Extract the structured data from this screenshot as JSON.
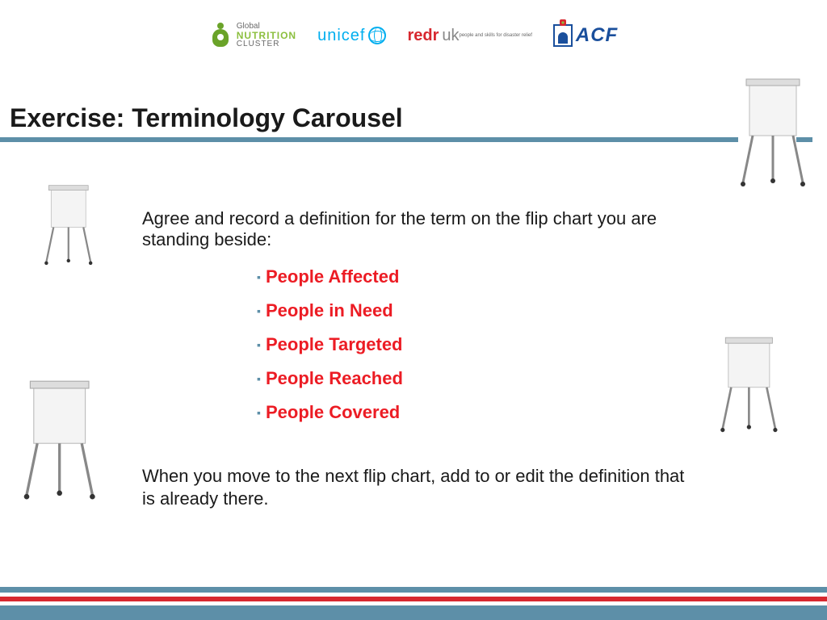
{
  "logos": {
    "gnc": {
      "line1": "Global",
      "line2": "NUTRITION",
      "line3": "CLUSTER"
    },
    "unicef": {
      "text": "unicef"
    },
    "redr": {
      "main1": "redr",
      "main2": "uk",
      "sub": "people and skills for disaster relief"
    },
    "acf": {
      "text": "ACF"
    }
  },
  "title": "Exercise:  Terminology Carousel",
  "intro": "Agree and record a definition for the term on the flip chart you are standing beside:",
  "terms": [
    "People Affected",
    "People in Need",
    "People Targeted",
    "People Reached",
    "People Covered"
  ],
  "outro": "When you move to the next flip chart, add to or edit the definition that is already there."
}
